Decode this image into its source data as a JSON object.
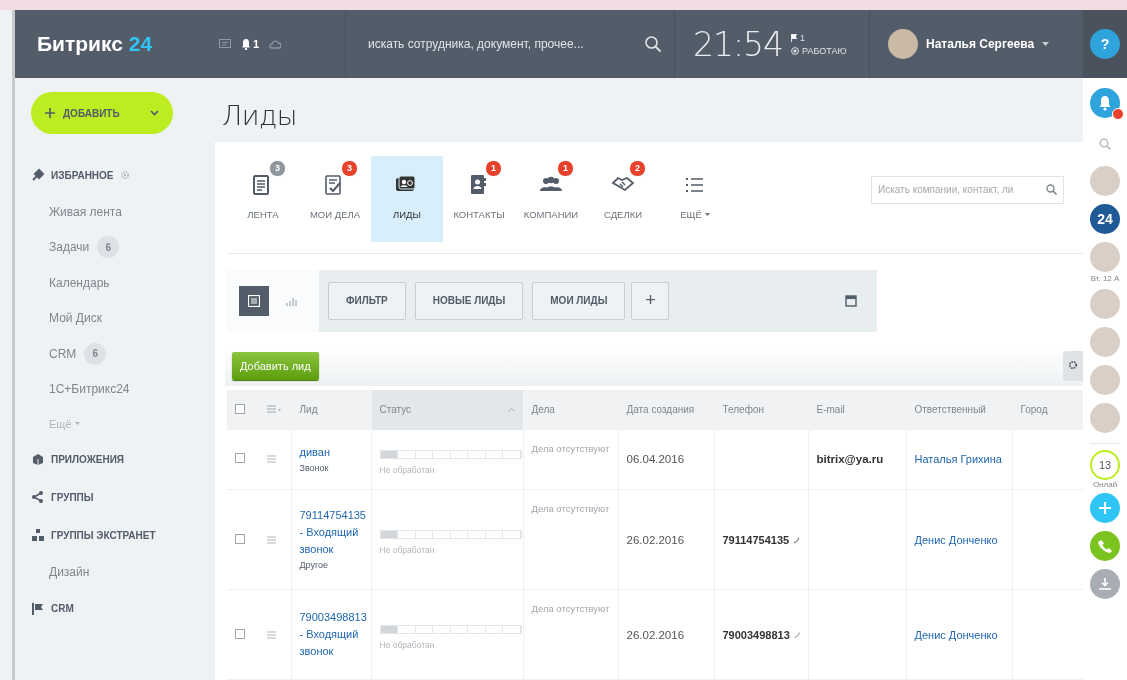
{
  "header": {
    "logo": {
      "name": "Битрикс",
      "number": "24"
    },
    "notifications": "1",
    "search": {
      "placeholder": "искать сотрудника, документ, прочее..."
    },
    "time": "21:54",
    "flag_count": "1",
    "work_status": "РАБОТАЮ",
    "user": "Наталья Сергеева",
    "help": "?"
  },
  "sidebar": {
    "add_button": "ДОБАВИТЬ",
    "items": [
      {
        "kind": "section",
        "label": "ИЗБРАННОЕ"
      },
      {
        "kind": "link",
        "label": "Живая лента"
      },
      {
        "kind": "link",
        "label": "Задачи",
        "count": "6"
      },
      {
        "kind": "link",
        "label": "Календарь"
      },
      {
        "kind": "link",
        "label": "Мой Диск"
      },
      {
        "kind": "link",
        "label": "CRM",
        "count": "6"
      },
      {
        "kind": "link",
        "label": "1С+Битрикс24"
      },
      {
        "kind": "more",
        "label": "Ещё"
      },
      {
        "kind": "section",
        "label": "ПРИЛОЖЕНИЯ"
      },
      {
        "kind": "section",
        "label": "ГРУППЫ"
      },
      {
        "kind": "section",
        "label": "ГРУППЫ ЭКСТРАНЕТ"
      },
      {
        "kind": "link",
        "label": "Дизайн"
      },
      {
        "kind": "section",
        "label": "CRM"
      }
    ]
  },
  "main": {
    "title": "Лиды",
    "tabs": [
      {
        "label": "ЛЕНТА",
        "badge": "3",
        "color": "#8f969c",
        "selected": false
      },
      {
        "label": "МОИ ДЕЛА",
        "badge": "3",
        "color": "#e8412c",
        "selected": false
      },
      {
        "label": "ЛИДЫ",
        "selected": true
      },
      {
        "label": "КОНТАКТЫ",
        "badge": "1",
        "color": "#e8412c",
        "selected": false
      },
      {
        "label": "КОМПАНИИ",
        "badge": "1",
        "color": "#e8412c",
        "selected": false
      },
      {
        "label": "СДЕЛКИ",
        "badge": "2",
        "color": "#e8412c",
        "selected": false
      },
      {
        "label": "ЕЩЁ",
        "selected": false
      }
    ],
    "search": {
      "placeholder": "Искать компании, контакт, ли"
    },
    "views": [
      {
        "kind": "list",
        "selected": true
      },
      {
        "kind": "chart",
        "selected": false
      }
    ],
    "filters": [
      "ФИЛЬТР",
      "НОВЫЕ ЛИДЫ",
      "МОИ ЛИДЫ"
    ],
    "add_filter": "+",
    "add_lead": "Добавить лид",
    "table": {
      "select_all": {
        "checked": false
      },
      "columns": [
        {
          "label": "Лид",
          "sorted": false
        },
        {
          "label": "Статус",
          "sorted": true
        },
        {
          "label": "Дела",
          "sorted": false
        },
        {
          "label": "Дата создания",
          "sorted": false
        },
        {
          "label": "Телефон",
          "sorted": false
        },
        {
          "label": "E-mail",
          "sorted": false
        },
        {
          "label": "Ответственный",
          "sorted": false
        },
        {
          "label": "Город",
          "sorted": false
        }
      ],
      "rows": [
        {
          "checked": false,
          "title": "диван",
          "source": "Звонок",
          "level": 0.12,
          "status": "Не обработан",
          "activities": "Дела отсутствуют",
          "date": "06.04.2016",
          "phone": "",
          "email": "bitrix@ya.ru",
          "responsible": "Наталья Грихина"
        },
        {
          "checked": false,
          "title": "79114754135 - Входящий звонок",
          "source": "Другое",
          "level": 0.12,
          "status": "Не обработан",
          "activities": "Дела отсутствуют",
          "date": "26.02.2016",
          "phone": "79114754135",
          "email": "",
          "responsible": "Денис Донченко"
        },
        {
          "checked": false,
          "title": "79003498813 - Входящий звонок",
          "level": 0.12,
          "status": "Не обработан",
          "activities": "Дела отсутствуют",
          "date": "26.02.2016",
          "phone": "79003498813",
          "email": "",
          "responsible": "Денис Донченко"
        }
      ]
    }
  },
  "rightbar": {
    "items": [
      {
        "kind": "bell"
      },
      {
        "kind": "search"
      },
      {
        "kind": "avatar"
      },
      {
        "kind": "group",
        "label": "24"
      },
      {
        "kind": "avatar"
      },
      {
        "kind": "date",
        "label": "Вт. 12 А"
      },
      {
        "kind": "avatar"
      },
      {
        "kind": "avatar"
      },
      {
        "kind": "avatar"
      },
      {
        "kind": "avatar"
      },
      {
        "kind": "online",
        "count": "13",
        "label": "Онлай"
      },
      {
        "kind": "add"
      },
      {
        "kind": "call"
      },
      {
        "kind": "download"
      }
    ]
  }
}
